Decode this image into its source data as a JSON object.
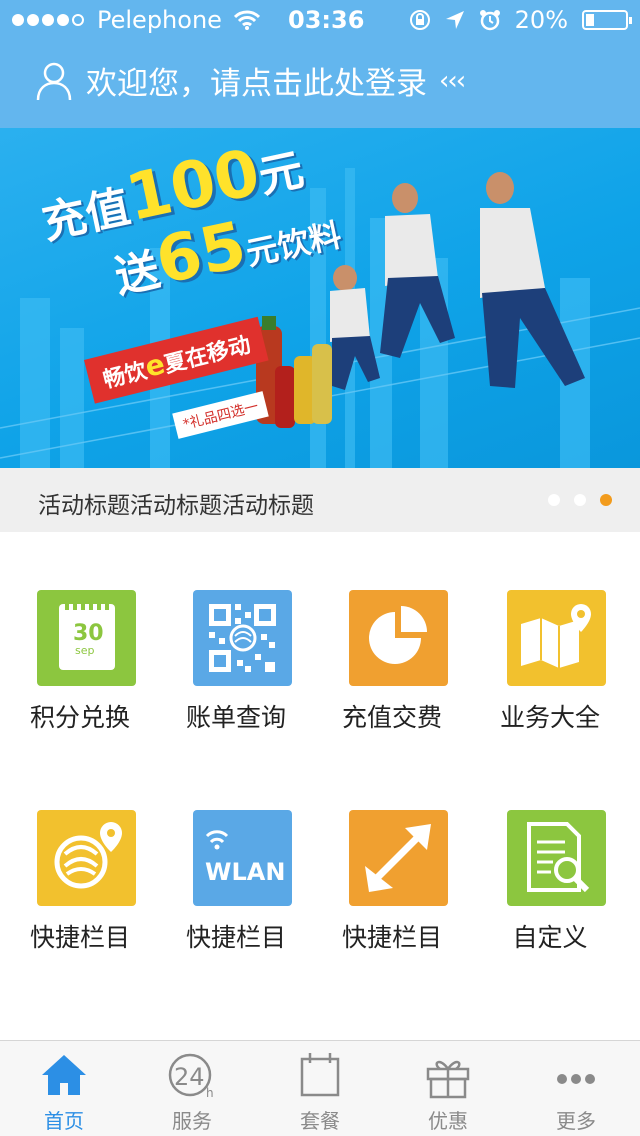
{
  "status_bar": {
    "carrier": "Pelephone",
    "time": "03:36",
    "battery_percent": "20%",
    "battery_level": 0.2,
    "signal_bars": 4
  },
  "header": {
    "login_prompt": "欢迎您，请点击此处登录",
    "chevrons": "‹‹‹",
    "color": "#63b6ee"
  },
  "banner": {
    "line1_prefix": "充值",
    "line1_amount": "100",
    "line1_suffix": "元",
    "line2_prefix": "送",
    "line2_amount": "65",
    "line2_suffix": "元饮料",
    "tag_part1": "畅饮",
    "tag_e": "e",
    "tag_part2": "夏在移动",
    "tag_note": "*礼品四选一"
  },
  "caption": {
    "title": "活动标题活动标题活动标题",
    "active_page": 3,
    "page_count": 3
  },
  "grid": {
    "items": [
      {
        "label": "积分兑换",
        "icon": "calendar-icon",
        "color": "#8cc63f",
        "icon_text": "30",
        "icon_subtext": "sep"
      },
      {
        "label": "账单查询",
        "icon": "qr-code-icon",
        "color": "#5aa8e6"
      },
      {
        "label": "充值交费",
        "icon": "pie-chart-icon",
        "color": "#f0a030"
      },
      {
        "label": "业务大全",
        "icon": "map-icon",
        "color": "#f2c12e"
      },
      {
        "label": "快捷栏目",
        "icon": "location-logo-icon",
        "color": "#f2c12e"
      },
      {
        "label": "快捷栏目",
        "icon": "wlan-icon",
        "color": "#5aa8e6",
        "icon_text": "WLAN"
      },
      {
        "label": "快捷栏目",
        "icon": "expand-arrows-icon",
        "color": "#f0a030"
      },
      {
        "label": "自定义",
        "icon": "document-search-icon",
        "color": "#8cc63f"
      }
    ]
  },
  "tabbar": {
    "active_color": "#2c8fe5",
    "items": [
      {
        "label": "首页",
        "icon": "home-icon",
        "active": true
      },
      {
        "label": "服务",
        "icon": "24h-icon",
        "active": false
      },
      {
        "label": "套餐",
        "icon": "package-icon",
        "active": false
      },
      {
        "label": "优惠",
        "icon": "gift-icon",
        "active": false
      },
      {
        "label": "更多",
        "icon": "more-icon",
        "active": false
      }
    ]
  }
}
